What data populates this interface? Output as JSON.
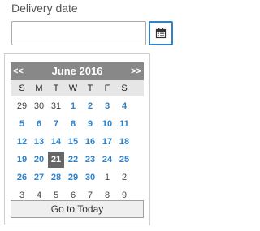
{
  "field": {
    "label": "Delivery date",
    "value": "",
    "placeholder": ""
  },
  "calendar_button": {
    "icon": "calendar-icon",
    "accent": "#2f82c8"
  },
  "calendar": {
    "prev_label": "<<",
    "next_label": ">>",
    "month_title": "June 2016",
    "weekdays": [
      "S",
      "M",
      "T",
      "W",
      "T",
      "F",
      "S"
    ],
    "weeks": [
      [
        {
          "d": "29",
          "m": "other"
        },
        {
          "d": "30",
          "m": "other"
        },
        {
          "d": "31",
          "m": "other"
        },
        {
          "d": "1",
          "m": "cur"
        },
        {
          "d": "2",
          "m": "cur"
        },
        {
          "d": "3",
          "m": "cur"
        },
        {
          "d": "4",
          "m": "cur"
        }
      ],
      [
        {
          "d": "5",
          "m": "cur"
        },
        {
          "d": "6",
          "m": "cur"
        },
        {
          "d": "7",
          "m": "cur"
        },
        {
          "d": "8",
          "m": "cur"
        },
        {
          "d": "9",
          "m": "cur"
        },
        {
          "d": "10",
          "m": "cur"
        },
        {
          "d": "11",
          "m": "cur"
        }
      ],
      [
        {
          "d": "12",
          "m": "cur"
        },
        {
          "d": "13",
          "m": "cur"
        },
        {
          "d": "14",
          "m": "cur"
        },
        {
          "d": "15",
          "m": "cur"
        },
        {
          "d": "16",
          "m": "cur"
        },
        {
          "d": "17",
          "m": "cur"
        },
        {
          "d": "18",
          "m": "cur"
        }
      ],
      [
        {
          "d": "19",
          "m": "cur"
        },
        {
          "d": "20",
          "m": "cur"
        },
        {
          "d": "21",
          "m": "sel"
        },
        {
          "d": "22",
          "m": "cur"
        },
        {
          "d": "23",
          "m": "cur"
        },
        {
          "d": "24",
          "m": "cur"
        },
        {
          "d": "25",
          "m": "cur"
        }
      ],
      [
        {
          "d": "26",
          "m": "cur"
        },
        {
          "d": "27",
          "m": "cur"
        },
        {
          "d": "28",
          "m": "cur"
        },
        {
          "d": "29",
          "m": "cur"
        },
        {
          "d": "30",
          "m": "cur"
        },
        {
          "d": "1",
          "m": "other"
        },
        {
          "d": "2",
          "m": "other"
        }
      ],
      [
        {
          "d": "3",
          "m": "other"
        },
        {
          "d": "4",
          "m": "other"
        },
        {
          "d": "5",
          "m": "other"
        },
        {
          "d": "6",
          "m": "other"
        },
        {
          "d": "7",
          "m": "other"
        },
        {
          "d": "8",
          "m": "other"
        },
        {
          "d": "9",
          "m": "other"
        }
      ]
    ],
    "today_label": "Go to Today",
    "colors": {
      "current_month": "#2f82c8",
      "other_month": "#444444",
      "selected_bg": "#666666",
      "header_bg": "#888888",
      "weekday_bg": "#e6e6e6"
    }
  }
}
